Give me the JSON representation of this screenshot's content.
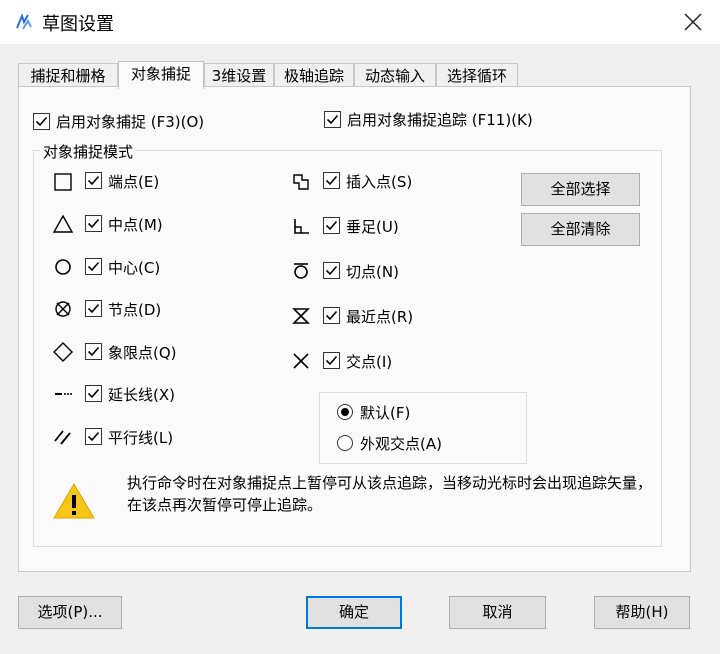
{
  "window": {
    "title": "草图设置"
  },
  "tabs": [
    "捕捉和栅格",
    "对象捕捉",
    "3维设置",
    "极轴追踪",
    "动态输入",
    "选择循环"
  ],
  "active_tab": 1,
  "top_options": {
    "osnap_on": "启用对象捕捉 (F3)(O)",
    "osnap_track": "启用对象捕捉追踪 (F11)(K)"
  },
  "group_title": "对象捕捉模式",
  "left_modes": [
    {
      "label": "端点(E)",
      "icon": "endpoint-square-icon",
      "checked": true
    },
    {
      "label": "中点(M)",
      "icon": "midpoint-triangle-icon",
      "checked": true
    },
    {
      "label": "中心(C)",
      "icon": "center-circle-icon",
      "checked": true
    },
    {
      "label": "节点(D)",
      "icon": "node-crossed-circle-icon",
      "checked": true
    },
    {
      "label": "象限点(Q)",
      "icon": "quadrant-diamond-icon",
      "checked": true
    },
    {
      "label": "延长线(X)",
      "icon": "extension-dashes-icon",
      "checked": true
    },
    {
      "label": "平行线(L)",
      "icon": "parallel-lines-icon",
      "checked": true
    }
  ],
  "right_modes": [
    {
      "label": "插入点(S)",
      "icon": "insertion-icon",
      "checked": true
    },
    {
      "label": "垂足(U)",
      "icon": "perpendicular-icon",
      "checked": true
    },
    {
      "label": "切点(N)",
      "icon": "tangent-icon",
      "checked": true
    },
    {
      "label": "最近点(R)",
      "icon": "nearest-hourglass-icon",
      "checked": true
    },
    {
      "label": "交点(I)",
      "icon": "intersection-x-icon",
      "checked": true
    }
  ],
  "radios": {
    "default_label": "默认(F)",
    "apparent_label": "外观交点(A)",
    "selected": "default"
  },
  "side_buttons": {
    "select_all": "全部选择",
    "clear_all": "全部清除"
  },
  "info_text": "执行命令时在对象捕捉点上暂停可从该点追踪，当移动光标时会出现追踪矢量，在该点再次暂停可停止追踪。",
  "footer": {
    "options": "选项(P)...",
    "ok": "确定",
    "cancel": "取消",
    "help": "帮助(H)"
  },
  "colors": {
    "accent": "#0078d7",
    "warning": "#f5c518"
  }
}
